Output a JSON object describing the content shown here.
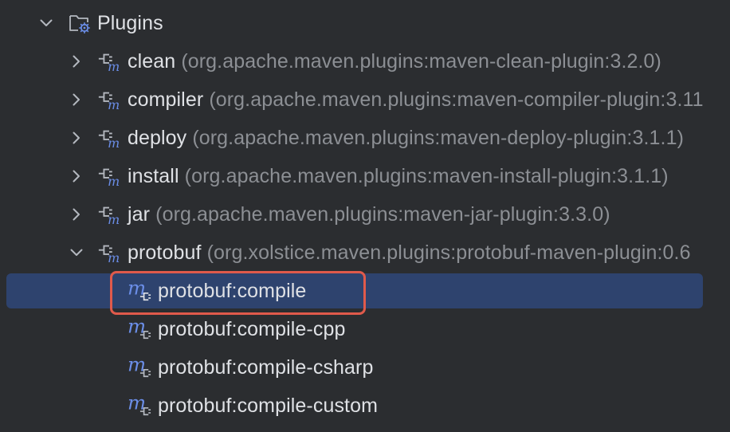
{
  "tree": {
    "plugins_folder": {
      "label": "Plugins",
      "expanded": true,
      "icon": "folder-gear-icon"
    },
    "plugins": [
      {
        "name": "clean",
        "coords": "(org.apache.maven.plugins:maven-clean-plugin:3.2.0)",
        "expanded": false
      },
      {
        "name": "compiler",
        "coords": "(org.apache.maven.plugins:maven-compiler-plugin:3.11",
        "expanded": false
      },
      {
        "name": "deploy",
        "coords": "(org.apache.maven.plugins:maven-deploy-plugin:3.1.1)",
        "expanded": false
      },
      {
        "name": "install",
        "coords": "(org.apache.maven.plugins:maven-install-plugin:3.1.1)",
        "expanded": false
      },
      {
        "name": "jar",
        "coords": "(org.apache.maven.plugins:maven-jar-plugin:3.3.0)",
        "expanded": false
      },
      {
        "name": "protobuf",
        "coords": "(org.xolstice.maven.plugins:protobuf-maven-plugin:0.6",
        "expanded": true
      }
    ],
    "goals": [
      {
        "label": "protobuf:compile",
        "selected": true
      },
      {
        "label": "protobuf:compile-cpp",
        "selected": false
      },
      {
        "label": "protobuf:compile-csharp",
        "selected": false
      },
      {
        "label": "protobuf:compile-custom",
        "selected": false
      }
    ]
  },
  "colors": {
    "background": "#2b2d30",
    "selection": "#2e436e",
    "text": "#dfe1e5",
    "coordinates": "#8c8f94",
    "maven_icon": "#6b8ee8",
    "highlight_border": "#e05a4b"
  }
}
